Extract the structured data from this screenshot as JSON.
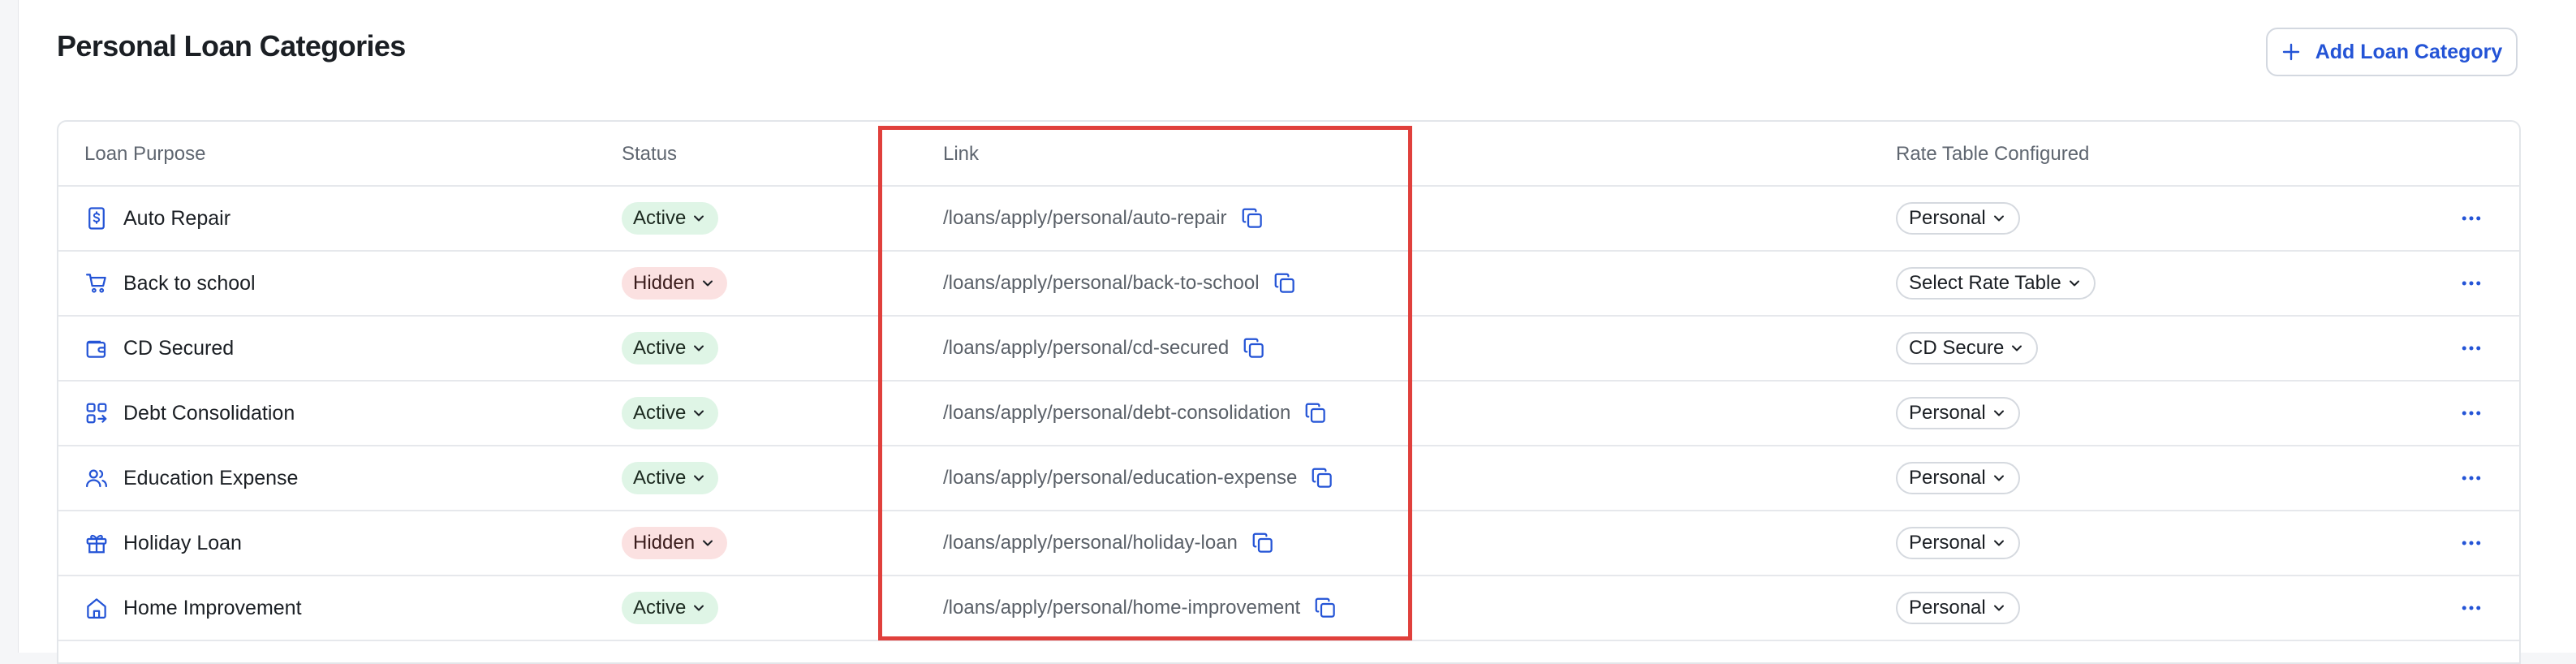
{
  "page": {
    "title": "Personal Loan Categories",
    "add_button_label": "Add Loan Category"
  },
  "colors": {
    "accent": "#2454d6",
    "active_bg": "#dff5e6",
    "hidden_bg": "#fbe1e1",
    "highlight_border": "#e0403c"
  },
  "table": {
    "columns": {
      "purpose": "Loan Purpose",
      "status": "Status",
      "link": "Link",
      "rate": "Rate Table Configured"
    },
    "rows": [
      {
        "purpose": "Auto Repair",
        "icon": "dollar-document-icon",
        "status": "Active",
        "link": "/loans/apply/personal/auto-repair",
        "rate": "Personal"
      },
      {
        "purpose": "Back to school",
        "icon": "shopping-cart-icon",
        "status": "Hidden",
        "link": "/loans/apply/personal/back-to-school",
        "rate": "Select Rate Table"
      },
      {
        "purpose": "CD Secured",
        "icon": "wallet-icon",
        "status": "Active",
        "link": "/loans/apply/personal/cd-secured",
        "rate": "CD Secure"
      },
      {
        "purpose": "Debt Consolidation",
        "icon": "consolidate-icon",
        "status": "Active",
        "link": "/loans/apply/personal/debt-consolidation",
        "rate": "Personal"
      },
      {
        "purpose": "Education Expense",
        "icon": "users-icon",
        "status": "Active",
        "link": "/loans/apply/personal/education-expense",
        "rate": "Personal"
      },
      {
        "purpose": "Holiday Loan",
        "icon": "gift-icon",
        "status": "Hidden",
        "link": "/loans/apply/personal/holiday-loan",
        "rate": "Personal"
      },
      {
        "purpose": "Home Improvement",
        "icon": "home-icon",
        "status": "Active",
        "link": "/loans/apply/personal/home-improvement",
        "rate": "Personal"
      }
    ]
  }
}
